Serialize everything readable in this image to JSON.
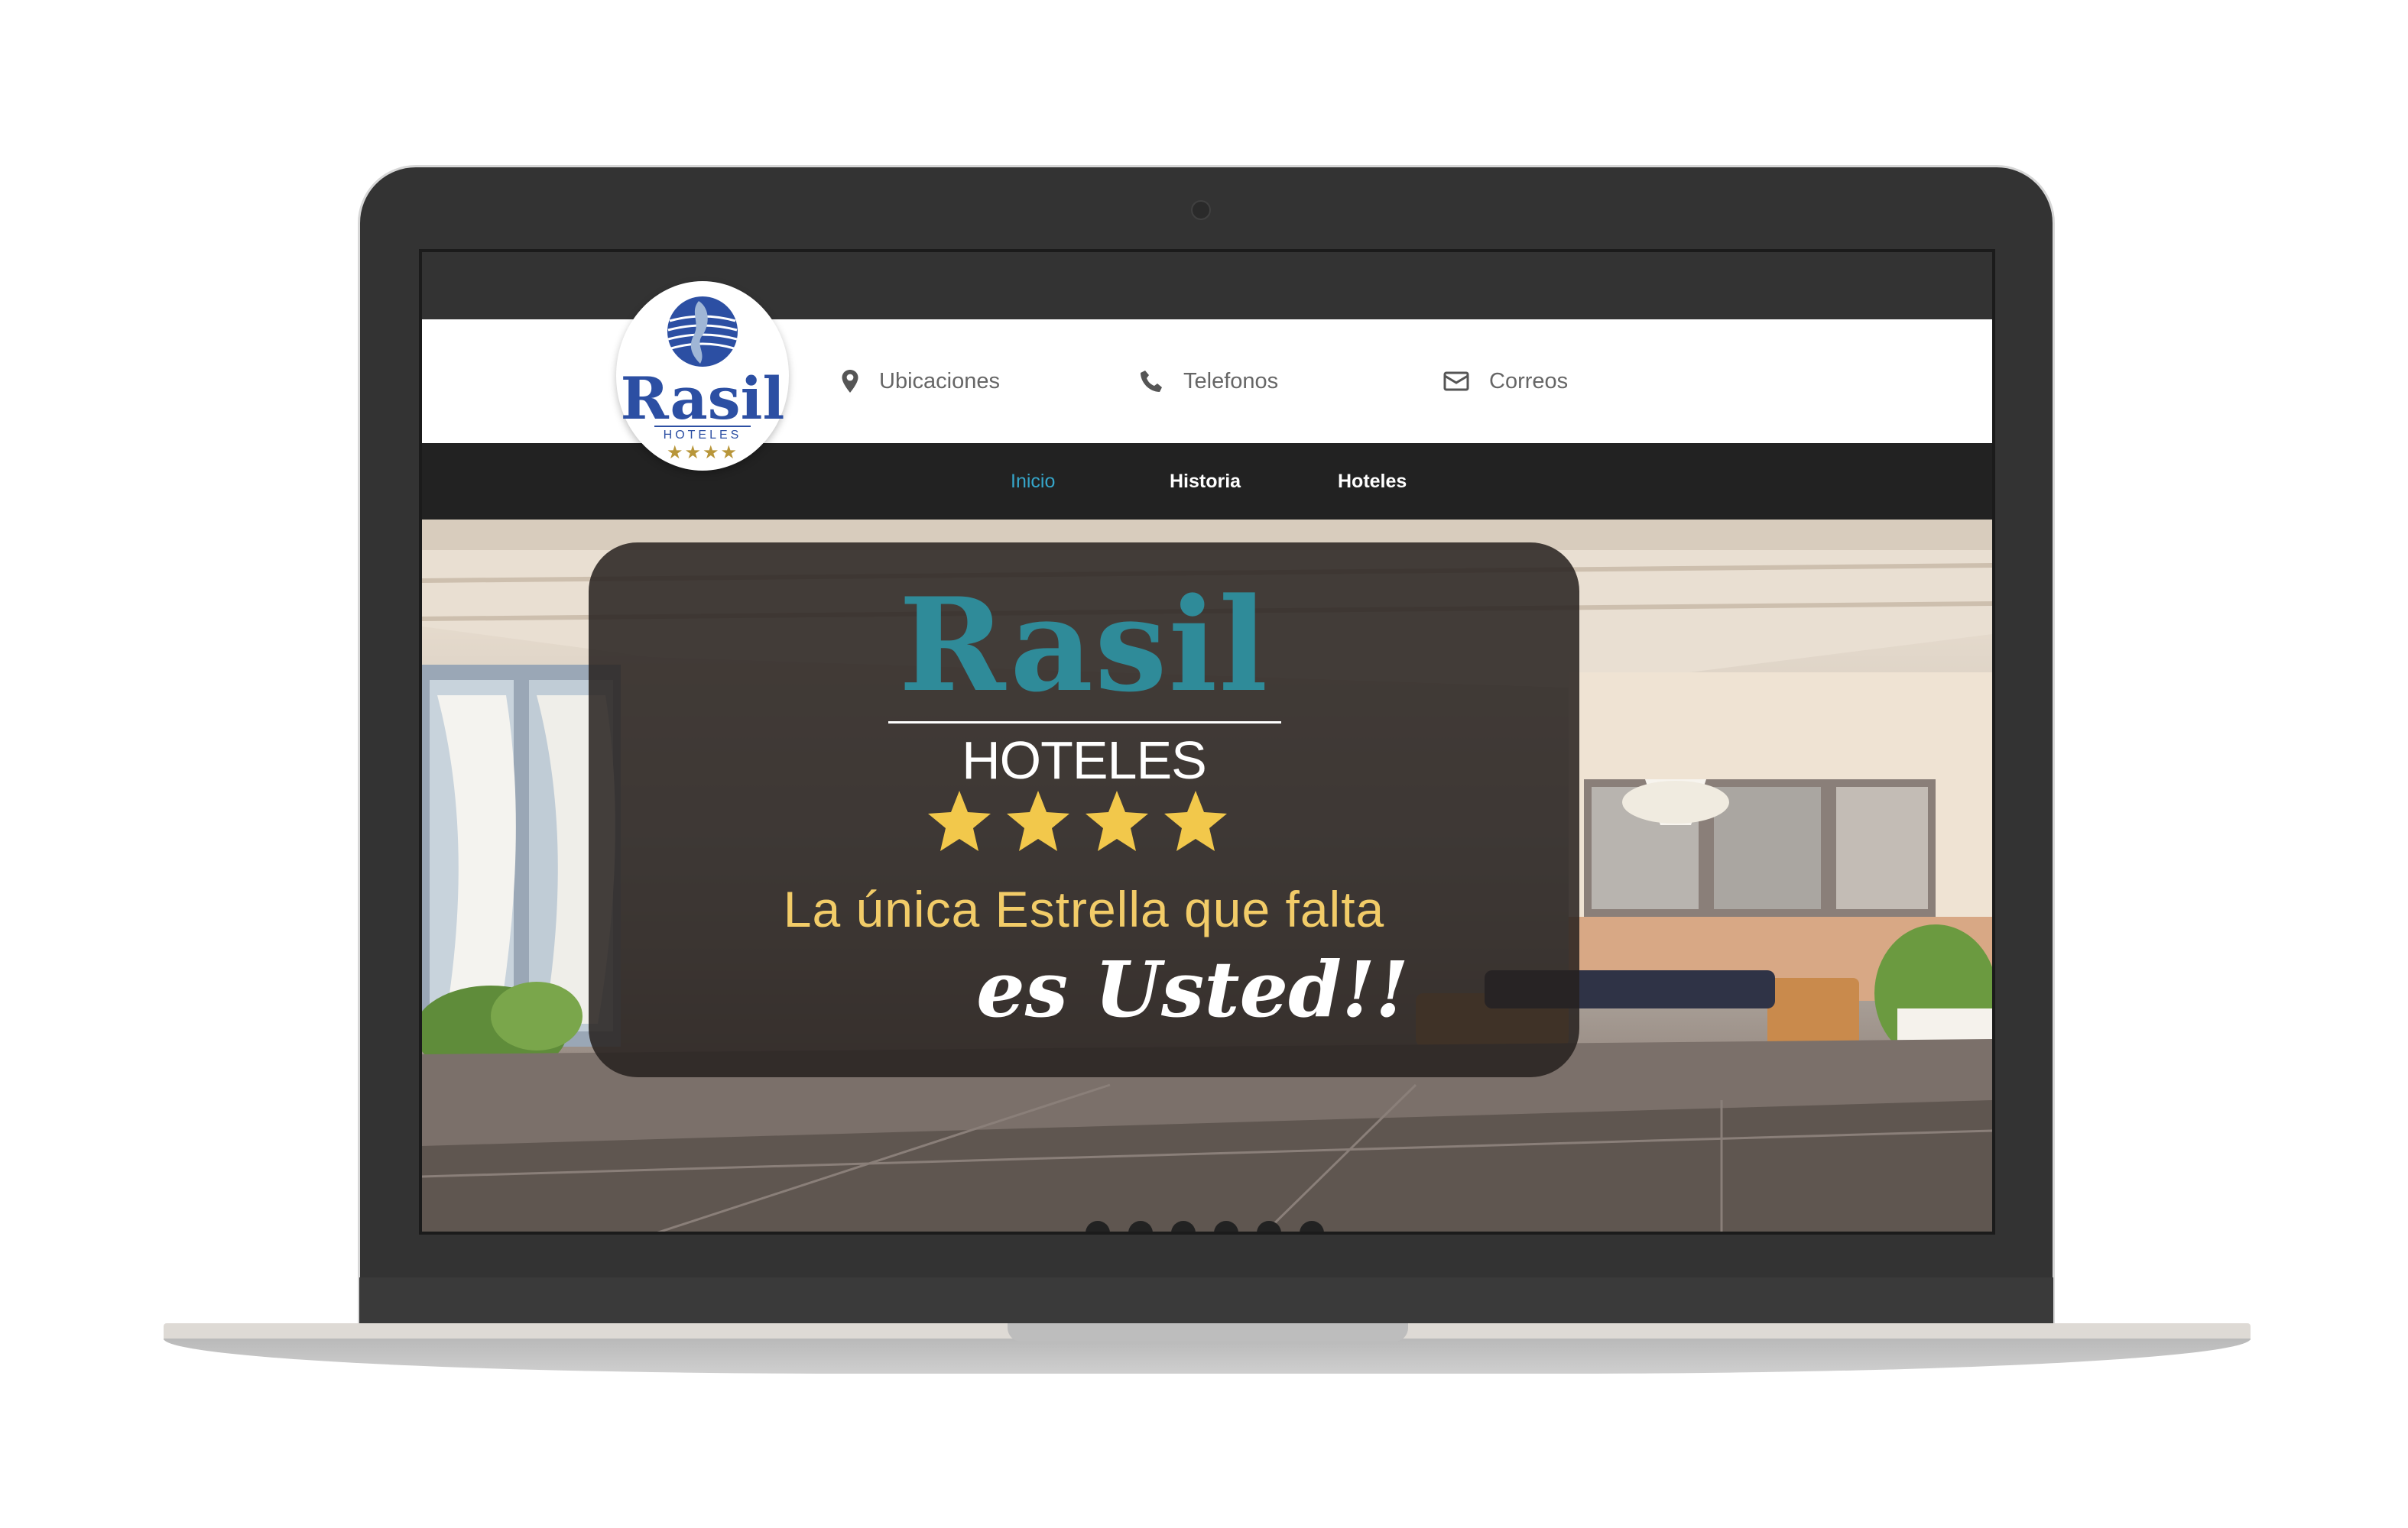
{
  "header": {
    "locations_label": "Ubicaciones",
    "phones_label": "Telefonos",
    "emails_label": "Correos"
  },
  "logo": {
    "name": "Rasil",
    "sub": "HOTELES"
  },
  "nav": {
    "items": [
      {
        "label": "Inicio",
        "active": true
      },
      {
        "label": "Historia",
        "active": false
      },
      {
        "label": "Hoteles",
        "active": false
      }
    ]
  },
  "hero": {
    "title": "Rasil",
    "subtitle": "HOTELES",
    "stars": 4,
    "tagline": "La única Estrella que falta",
    "tagline2": "es Usted!!"
  },
  "slider": {
    "dot_count": 6
  },
  "colors": {
    "accent": "#35a5c9",
    "brand_teal": "#2f8b99",
    "brand_blue": "#2c4fa3",
    "star_gold": "#f2c84b",
    "nav_bg": "#222222"
  }
}
